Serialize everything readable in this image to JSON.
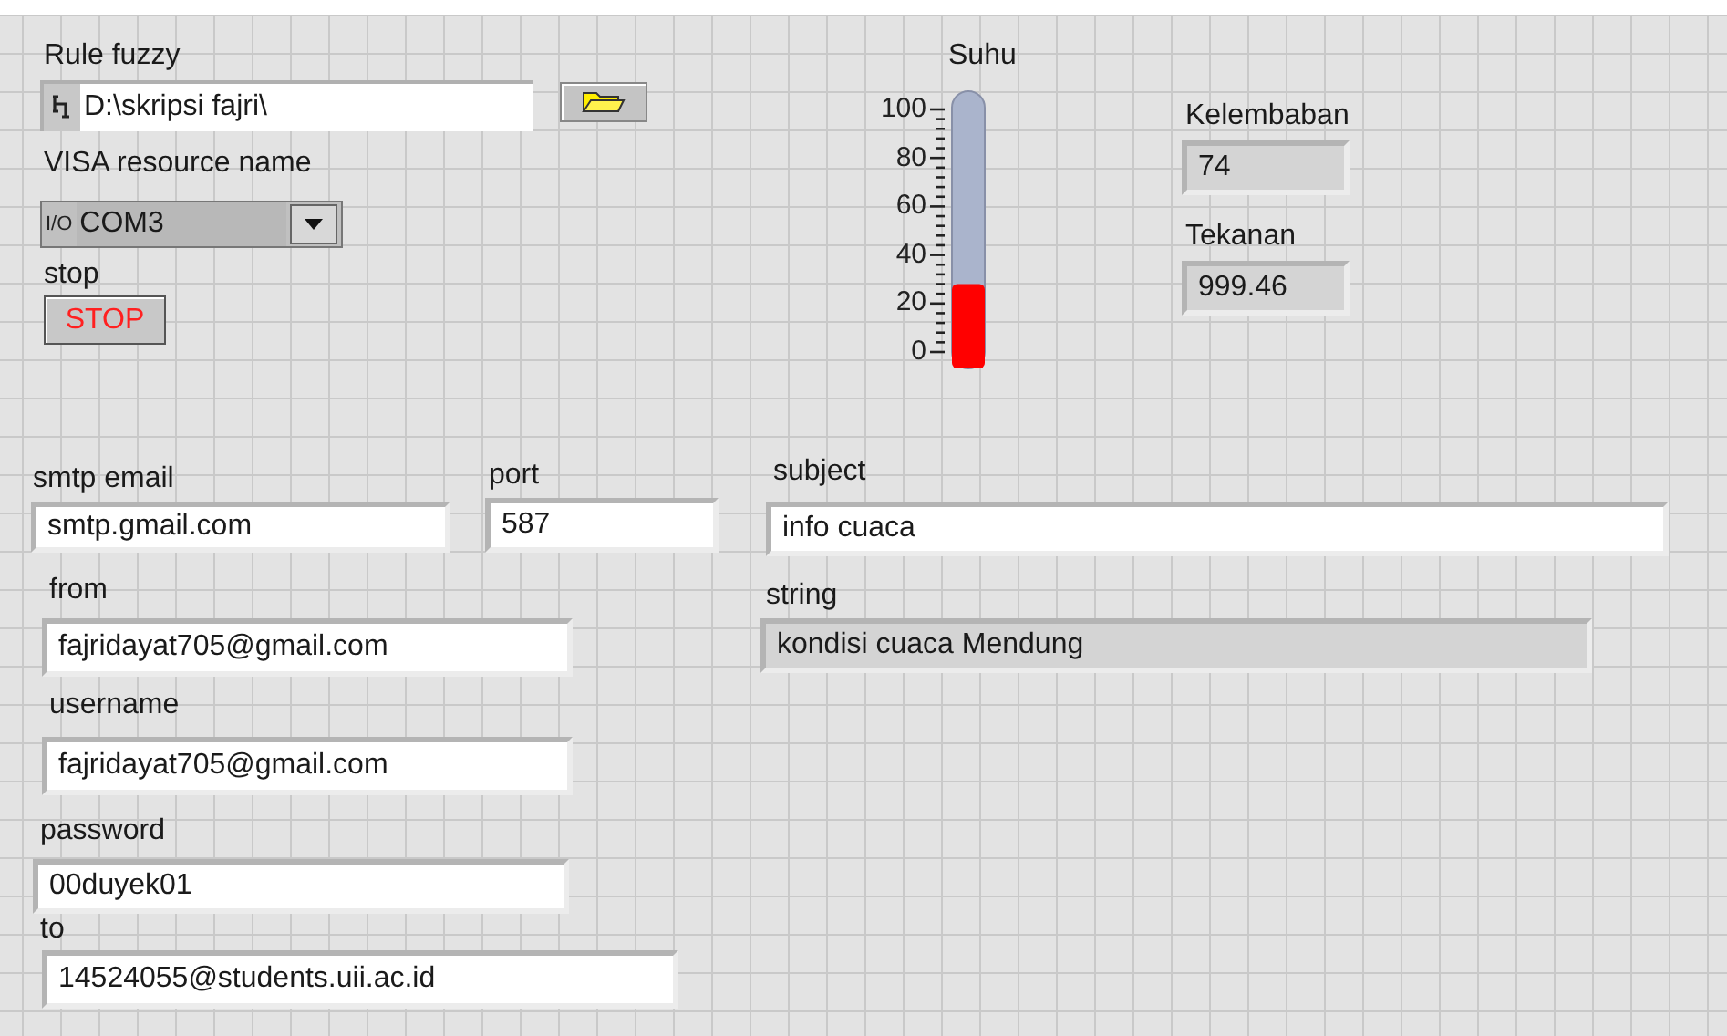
{
  "rule_fuzzy": {
    "label": "Rule fuzzy",
    "value": "D:\\skripsi fajri\\"
  },
  "visa_resource": {
    "label": "VISA resource name",
    "icon_text": "I/O",
    "value": "COM3"
  },
  "stop": {
    "label": "stop",
    "button": "STOP"
  },
  "suhu": {
    "label": "Suhu",
    "level": 0.28,
    "scale": [
      "100",
      "80",
      "60",
      "40",
      "20",
      "0"
    ]
  },
  "kelembaban": {
    "label": "Kelembaban",
    "value": "74",
    "kind": "indicator"
  },
  "tekanan": {
    "label": "Tekanan",
    "value": "999.46",
    "kind": "indicator"
  },
  "smtp_email": {
    "label": "smtp email",
    "value": "smtp.gmail.com",
    "kind": "control"
  },
  "port": {
    "label": "port",
    "value": "587",
    "kind": "control"
  },
  "subject": {
    "label": "subject",
    "value": "info cuaca",
    "kind": "control"
  },
  "string": {
    "label": "string",
    "value": "kondisi cuaca Mendung",
    "kind": "indicator"
  },
  "from": {
    "label": "from",
    "value": "fajridayat705@gmail.com",
    "kind": "control"
  },
  "username": {
    "label": "username",
    "value": "fajridayat705@gmail.com",
    "kind": "control"
  },
  "password": {
    "label": "password",
    "value": "00duyek01",
    "kind": "control"
  },
  "to": {
    "label": "to",
    "value": "14524055@students.uii.ac.id",
    "kind": "control"
  }
}
